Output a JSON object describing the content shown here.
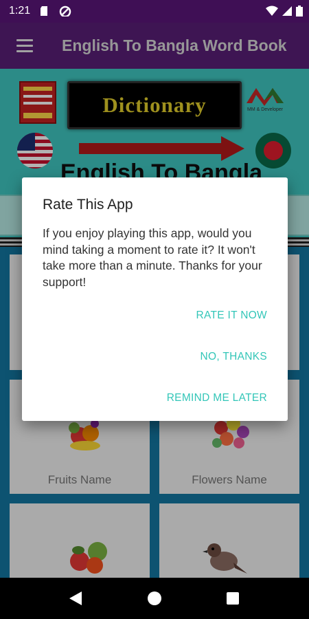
{
  "status_bar": {
    "time": "1:21"
  },
  "app_bar": {
    "title": "English To Bangla Word Book"
  },
  "banner": {
    "logo_text": "Dictionary",
    "headline": "English To Bangla",
    "developer": "MM & Developer"
  },
  "cards": [
    {
      "label": "Fruits Name",
      "icon": "fruits-icon"
    },
    {
      "label": "Flowers Name",
      "icon": "flowers-icon"
    },
    {
      "label": "",
      "icon": "vegetables-icon"
    },
    {
      "label": "",
      "icon": "bird-icon"
    }
  ],
  "dialog": {
    "title": "Rate This App",
    "message": "If you enjoy playing this app, would you mind taking a moment to rate it? It won't take more than a minute. Thanks for your support!",
    "rate_now": "RATE IT NOW",
    "no_thanks": "NO, THANKS",
    "remind_later": "REMIND ME LATER"
  },
  "colors": {
    "status_bar": "#3f0f55",
    "app_bar": "#5a1f78",
    "accent": "#33c6b8",
    "content_bg": "#1478a3"
  }
}
